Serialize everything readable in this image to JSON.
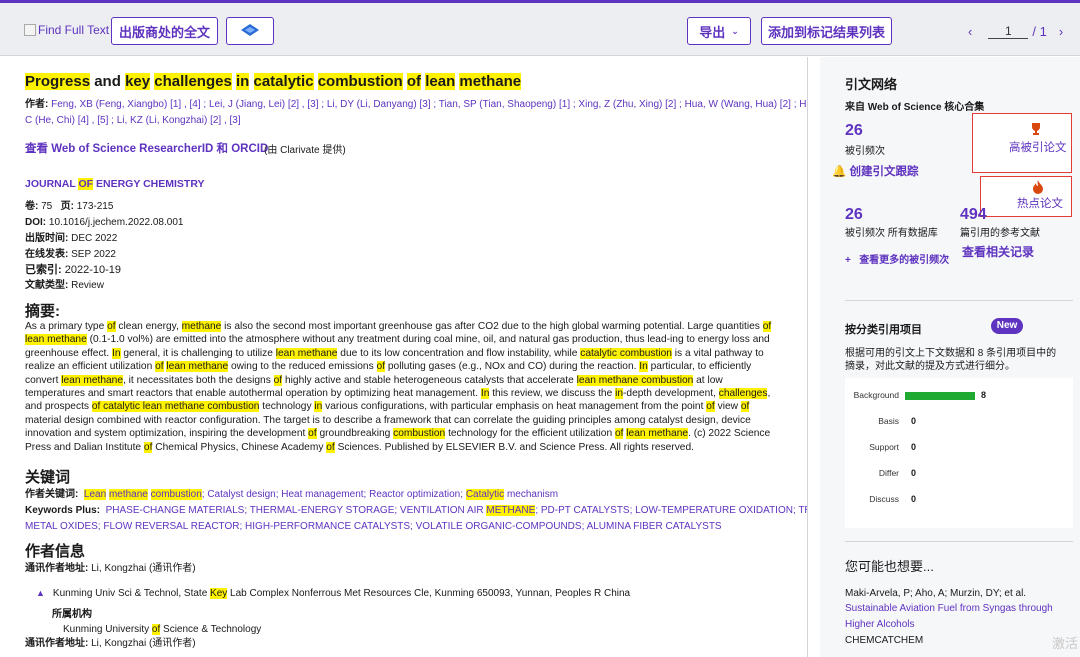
{
  "toolbar": {
    "find_full_text": "Find Full Text",
    "publisher_full_text": "出版商处的全文",
    "export": "导出",
    "add_to_marked": "添加到标记结果列表",
    "page_current": "1",
    "page_total": "/ 1"
  },
  "record": {
    "title_parts": [
      [
        "Progress",
        1
      ],
      [
        " and ",
        0
      ],
      [
        "key",
        1
      ],
      [
        " ",
        0
      ],
      [
        "challenges",
        1
      ],
      [
        " ",
        0
      ],
      [
        "in",
        1
      ],
      [
        " ",
        0
      ],
      [
        "catalytic",
        1
      ],
      [
        " ",
        0
      ],
      [
        "combustion",
        1
      ],
      [
        " ",
        0
      ],
      [
        "of",
        1
      ],
      [
        " ",
        0
      ],
      [
        "lean",
        1
      ],
      [
        " ",
        0
      ],
      [
        "methane",
        1
      ]
    ],
    "authors_label": "作者:",
    "authors_line1": "Feng, XB (Feng, Xiangbo) [1] , [4] ; Lei, J (Jiang, Lei) [2] , [3] ; Li, DY (Li, Danyang) [3] ; Tian, SP (Tian, Shaopeng) [1] ; Xing, Z (Zhu, Xing) [2] ; Hua, W (Wang, Hua) [2] ; He,",
    "authors_line2": "C (He, Chi) [4] , [5] ; Li, KZ (Li, Kongzhai) [2] , [3]",
    "researcher_link": "查看 Web of Science ResearcherID 和 ORCID",
    "provided_by": "(由 Clarivate 提供)",
    "journal_parts": [
      [
        "JOURNAL ",
        0
      ],
      [
        "OF",
        1
      ],
      [
        " ENERGY CHEMISTRY",
        0
      ]
    ],
    "volume_label": "卷:",
    "volume": "75",
    "pages_label": "页:",
    "pages": "173-215",
    "doi_label": "DOI:",
    "doi": "10.1016/j.jechem.2022.08.001",
    "pubdate_label": "出版时间:",
    "pubdate": "DEC 2022",
    "online_label": "在线发表:",
    "online": "SEP 2022",
    "indexed_label": "已索引:",
    "indexed": "2022-10-19",
    "doctype_label": "文献类型:",
    "doctype": "Review",
    "abstract_heading": "摘要:",
    "abstract_parts": [
      [
        "As a primary type ",
        0
      ],
      [
        "of",
        1
      ],
      [
        " clean energy, ",
        0
      ],
      [
        "methane",
        1
      ],
      [
        " is also the second most important greenhouse gas after CO2 due to the high global warming potential. Large quantities ",
        0
      ],
      [
        "of",
        1
      ],
      [
        " ",
        0
      ],
      [
        "lean methane",
        1
      ],
      [
        " (0.1-1.0 vol%) are emitted into the atmosphere without any treatment during coal mine, oil, and natural gas production, thus lead-ing to energy loss and greenhouse effect. ",
        0
      ],
      [
        "In",
        1
      ],
      [
        " general, it is challenging to utilize ",
        0
      ],
      [
        "lean methane",
        1
      ],
      [
        " due to its low concentration and flow instability, while ",
        0
      ],
      [
        "catalytic combustion",
        1
      ],
      [
        " is a vital pathway to realize an efficient utilization ",
        0
      ],
      [
        "of",
        1
      ],
      [
        " ",
        0
      ],
      [
        "lean methane",
        1
      ],
      [
        " owing to the reduced emissions ",
        0
      ],
      [
        "of",
        1
      ],
      [
        " polluting gases (e.g., NOx and CO) during the reaction. ",
        0
      ],
      [
        "In",
        1
      ],
      [
        " particular, to efficiently convert ",
        0
      ],
      [
        "lean methane",
        1
      ],
      [
        ", it necessitates both the designs ",
        0
      ],
      [
        "of",
        1
      ],
      [
        " highly active and stable heterogeneous catalysts that accelerate ",
        0
      ],
      [
        "lean methane combustion",
        1
      ],
      [
        " at low temperatures and smart reactors that enable autothermal operation by optimizing heat management. ",
        0
      ],
      [
        "In",
        1
      ],
      [
        " this review, we discuss the ",
        0
      ],
      [
        "in",
        1
      ],
      [
        "-depth development, ",
        0
      ],
      [
        "challenges",
        1
      ],
      [
        ", and prospects ",
        0
      ],
      [
        "of catalytic lean methane combustion",
        1
      ],
      [
        " technology ",
        0
      ],
      [
        "in",
        1
      ],
      [
        " various configurations, with particular emphasis on heat management from the point ",
        0
      ],
      [
        "of",
        1
      ],
      [
        " view ",
        0
      ],
      [
        "of",
        1
      ],
      [
        " material design combined with reactor configuration. The target is to describe a framework that can correlate the guiding principles among catalyst design, device innovation and system optimization, inspiring the development ",
        0
      ],
      [
        "of",
        1
      ],
      [
        " groundbreaking ",
        0
      ],
      [
        "combustion",
        1
      ],
      [
        " technology for the efficient utilization ",
        0
      ],
      [
        "of",
        1
      ],
      [
        " ",
        0
      ],
      [
        "lean methane",
        1
      ],
      [
        ". (c) 2022 Science Press and Dalian Institute ",
        0
      ],
      [
        "of",
        1
      ],
      [
        " Chemical Physics, Chinese Academy ",
        0
      ],
      [
        "of",
        1
      ],
      [
        " Sciences. Published by ELSEVIER B.V. and Science Press. All rights reserved.",
        0
      ]
    ],
    "keywords_heading": "关键词",
    "author_kw_label": "作者关键词:",
    "author_kw_parts": [
      [
        "Lean",
        1
      ],
      [
        " ",
        0
      ],
      [
        "methane",
        1
      ],
      [
        " ",
        0
      ],
      [
        "combustion",
        1
      ],
      [
        "; Catalyst design; Heat management; Reactor optimization; ",
        0
      ],
      [
        "Catalytic",
        1
      ],
      [
        " mechanism",
        0
      ]
    ],
    "kw_plus_label": "Keywords Plus:",
    "kw_plus_line1_parts": [
      [
        "PHASE-CHANGE MATERIALS; THERMAL-ENERGY STORAGE; VENTILATION AIR ",
        0
      ],
      [
        "METHANE",
        1
      ],
      [
        "; PD-PT CATALYSTS; LOW-TEMPERATURE OXIDATION; TRANSITION-",
        0
      ]
    ],
    "kw_plus_line2": "METAL OXIDES; FLOW REVERSAL REACTOR; HIGH-PERFORMANCE CATALYSTS; VOLATILE ORGANIC-COMPOUNDS; ALUMINA FIBER CATALYSTS",
    "author_info_heading": "作者信息",
    "corr_label": "通讯作者地址:",
    "corr_value": "Li, Kongzhai (通讯作者)",
    "address_parts": [
      [
        "Kunming Univ Sci & Technol, State ",
        0
      ],
      [
        "Key",
        1
      ],
      [
        " Lab Complex Nonferrous Met Resources Cle, Kunming 650093, Yunnan, Peoples R China",
        0
      ]
    ],
    "affil_label": "所属机构",
    "affil_parts": [
      [
        "Kunming University ",
        0
      ],
      [
        "of",
        1
      ],
      [
        " Science & Technology",
        0
      ]
    ],
    "corr2_label": "通讯作者地址:",
    "corr2_value": "Li, Kongzhai (通讯作者)"
  },
  "sidebar": {
    "citation_network": "引文网络",
    "core_collection": "来自 Web of Science 核心合集",
    "cited_count": "26",
    "cited_label": "被引频次",
    "highly_cited": "高被引论文",
    "hot_paper": "热点论文",
    "create_alert": "创建引文跟踪",
    "all_db_count": "26",
    "all_db_label": "被引频次 所有数据库",
    "refs_count": "494",
    "refs_label": "篇引用的参考文献",
    "view_more_cited": "查看更多的被引频次",
    "view_related": "查看相关记录",
    "cite_items_heading": "按分类引用项目",
    "new_badge": "New",
    "cite_desc_line1": "根据可用的引文上下文数据和 8 条引用项目中的",
    "cite_desc_line2": "摘录，对此文献的提及方式进行细分。",
    "categories": [
      {
        "label": "Background",
        "value": 8
      },
      {
        "label": "Basis",
        "value": 0
      },
      {
        "label": "Support",
        "value": 0
      },
      {
        "label": "Differ",
        "value": 0
      },
      {
        "label": "Discuss",
        "value": 0
      }
    ],
    "might_like_heading": "您可能也想要...",
    "sugg_authors": "Maki-Arvela, P; Aho, A; Murzin, DY; et al.",
    "sugg_title_line1": "Sustainable Aviation Fuel from Syngas through",
    "sugg_title_line2": "Higher Alcohols",
    "sugg_journal": "CHEMCATCHEM",
    "watermark": "激活"
  },
  "colors": {
    "accent": "#5e33bf",
    "highlight": "#fff200",
    "bar": "#1fa832",
    "badge": "#5e33bf"
  }
}
